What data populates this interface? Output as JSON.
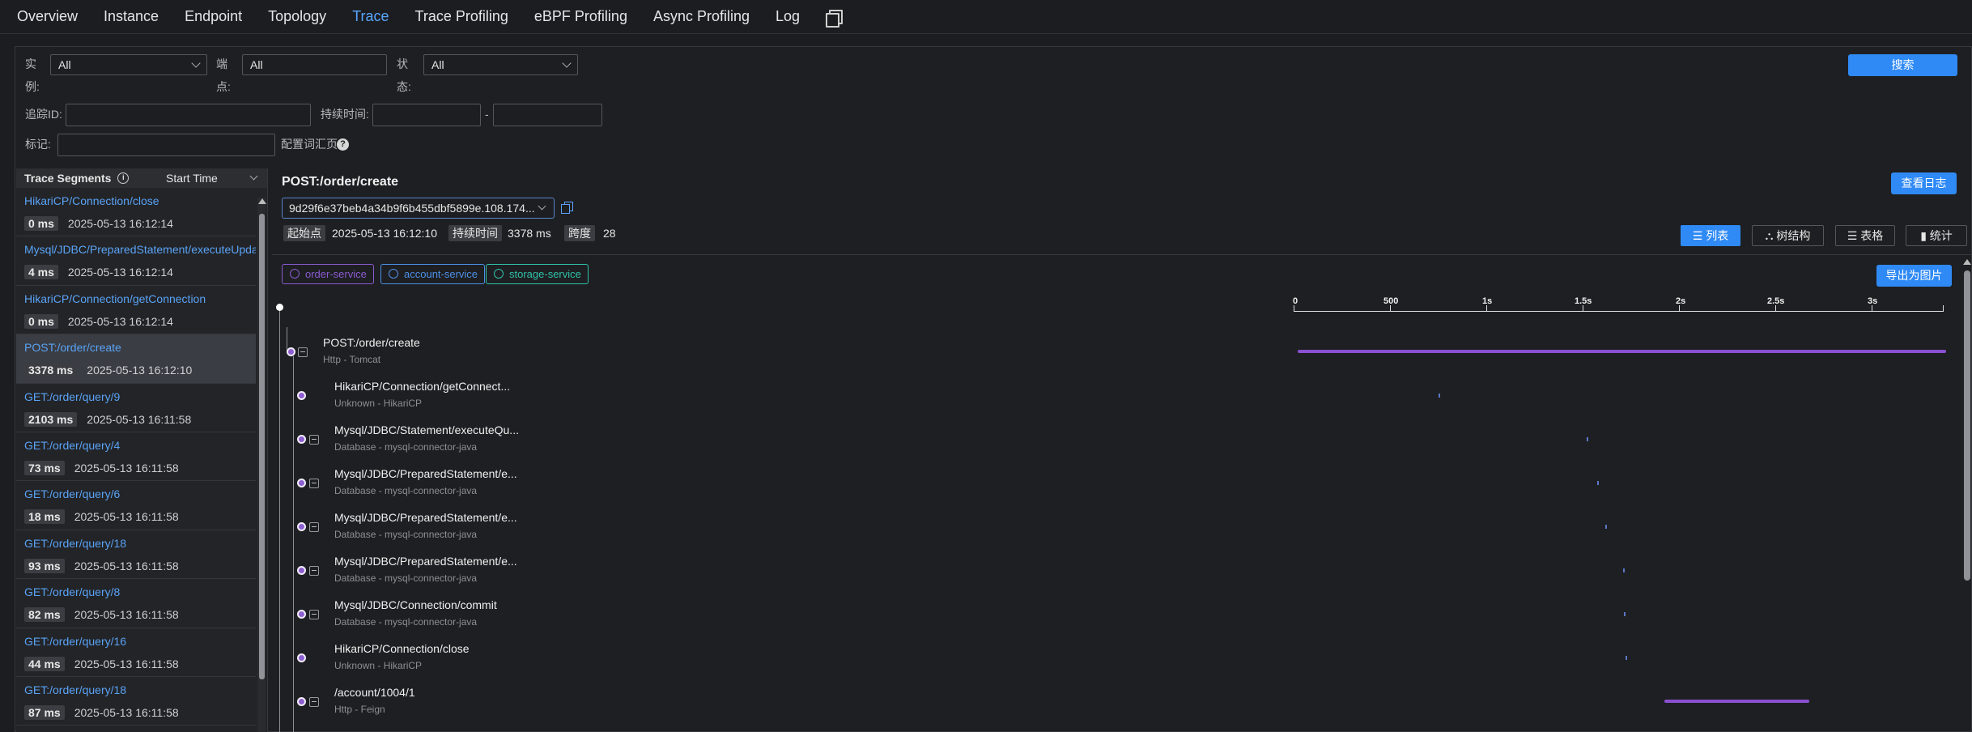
{
  "nav": {
    "tabs": [
      "Overview",
      "Instance",
      "Endpoint",
      "Topology",
      "Trace",
      "Trace Profiling",
      "eBPF Profiling",
      "Async Profiling",
      "Log"
    ],
    "active": "Trace"
  },
  "filters": {
    "instance_label_1": "实",
    "instance_label_2": "例:",
    "instance_value": "All",
    "endpoint_label_1": "端",
    "endpoint_label_2": "点:",
    "endpoint_value": "All",
    "status_label_1": "状",
    "status_label_2": "态:",
    "status_value": "All",
    "trace_id_label": "追踪ID:",
    "duration_label": "持续时间:",
    "duration_sep": "-",
    "tags_label": "标记:",
    "config_label": "配置词汇页",
    "search_button": "搜索"
  },
  "segments": {
    "header": "Trace Segments",
    "sort": "Start Time",
    "items": [
      {
        "name": "HikariCP/Connection/close",
        "dur": "0 ms",
        "time": "2025-05-13 16:12:14"
      },
      {
        "name": "Mysql/JDBC/PreparedStatement/executeUpdate",
        "dur": "4 ms",
        "time": "2025-05-13 16:12:14"
      },
      {
        "name": "HikariCP/Connection/getConnection",
        "dur": "0 ms",
        "time": "2025-05-13 16:12:14"
      },
      {
        "name": "POST:/order/create",
        "dur": "3378 ms",
        "time": "2025-05-13 16:12:10"
      },
      {
        "name": "GET:/order/query/9",
        "dur": "2103 ms",
        "time": "2025-05-13 16:11:58"
      },
      {
        "name": "GET:/order/query/4",
        "dur": "73 ms",
        "time": "2025-05-13 16:11:58"
      },
      {
        "name": "GET:/order/query/6",
        "dur": "18 ms",
        "time": "2025-05-13 16:11:58"
      },
      {
        "name": "GET:/order/query/18",
        "dur": "93 ms",
        "time": "2025-05-13 16:11:58"
      },
      {
        "name": "GET:/order/query/8",
        "dur": "82 ms",
        "time": "2025-05-13 16:11:58"
      },
      {
        "name": "GET:/order/query/16",
        "dur": "44 ms",
        "time": "2025-05-13 16:11:58"
      },
      {
        "name": "GET:/order/query/18",
        "dur": "87 ms",
        "time": "2025-05-13 16:11:58"
      }
    ]
  },
  "detail": {
    "title": "POST:/order/create",
    "view_logs": "查看日志",
    "trace_id": "9d29f6e37beb4a34b9f6b455dbf5899e.108.174...",
    "start_label": "起始点",
    "start_value": "2025-05-13 16:12:10",
    "duration_label": "持续时间",
    "duration_value": "3378 ms",
    "span_label": "跨度",
    "span_value": "28",
    "views": {
      "list": "列表",
      "tree": "树结构",
      "table": "表格",
      "stats": "统计"
    },
    "export": "导出为图片",
    "services": [
      {
        "name": "order-service",
        "color": "#8a5ad0"
      },
      {
        "name": "account-service",
        "color": "#4d8fe6"
      },
      {
        "name": "storage-service",
        "color": "#30c1a8"
      }
    ],
    "axis_ticks": [
      "0",
      "500",
      "1s",
      "1.5s",
      "2s",
      "2.5s",
      "3s"
    ],
    "spans": [
      {
        "name": "POST:/order/create",
        "sub": "Http - Tomcat"
      },
      {
        "name": "HikariCP/Connection/getConnect...",
        "sub": "Unknown - HikariCP"
      },
      {
        "name": "Mysql/JDBC/Statement/executeQu...",
        "sub": "Database - mysql-connector-java"
      },
      {
        "name": "Mysql/JDBC/PreparedStatement/e...",
        "sub": "Database - mysql-connector-java"
      },
      {
        "name": "Mysql/JDBC/PreparedStatement/e...",
        "sub": "Database - mysql-connector-java"
      },
      {
        "name": "Mysql/JDBC/PreparedStatement/e...",
        "sub": "Database - mysql-connector-java"
      },
      {
        "name": "Mysql/JDBC/Connection/commit",
        "sub": "Database - mysql-connector-java"
      },
      {
        "name": "HikariCP/Connection/close",
        "sub": "Unknown - HikariCP"
      },
      {
        "name": "/account/1004/1",
        "sub": "Http - Feign"
      }
    ]
  }
}
